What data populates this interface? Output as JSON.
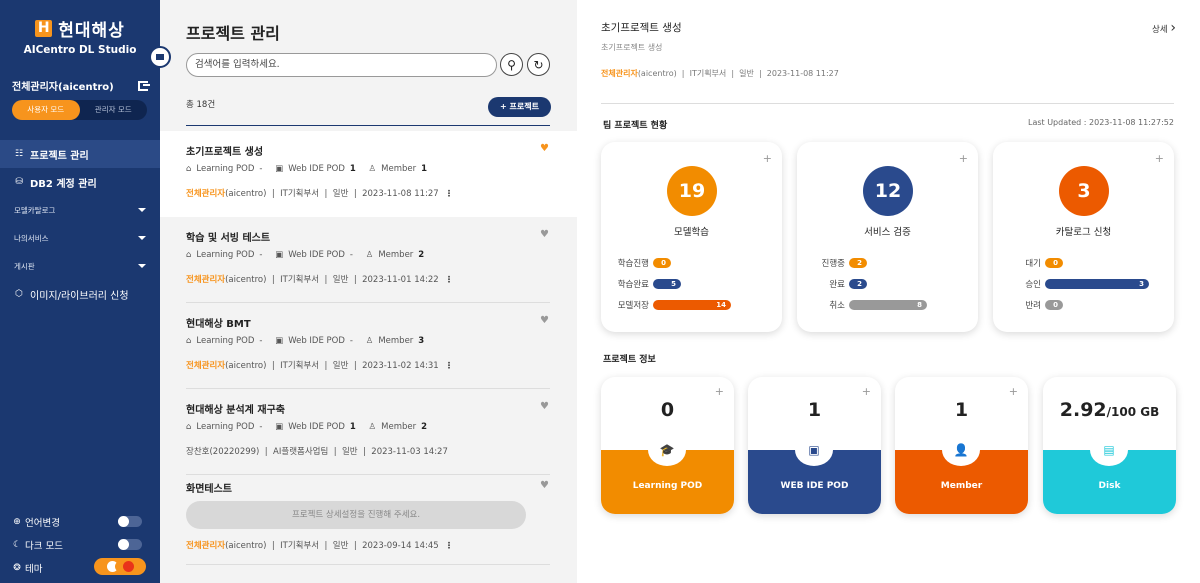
{
  "brand": {
    "name": "현대해상",
    "mark": "H",
    "studio": "AICentro DL Studio"
  },
  "user": {
    "name": "전체관리자(aicentro)"
  },
  "mode": {
    "user": "사용자 모드",
    "admin": "관리자 모드"
  },
  "nav": [
    {
      "label": "프로젝트 관리",
      "icon": "project-list-icon",
      "glyph": "☷"
    },
    {
      "label": "DB2 계정 관리",
      "icon": "database-icon",
      "glyph": "⛁"
    },
    {
      "label": "모델카탈로그"
    },
    {
      "label": "나의서비스"
    },
    {
      "label": "게시판"
    },
    {
      "label": "이미지/라이브러리 신청",
      "icon": "cube-icon",
      "glyph": "⬡"
    }
  ],
  "bottom": {
    "language": "언어변경",
    "dark": "다크 모드",
    "theme": "테마"
  },
  "list": {
    "title": "프로젝트 관리",
    "search_placeholder": "검색어를 입력하세요.",
    "count": "총 18건",
    "add": "+ 프로젝트",
    "labels": {
      "learning": "Learning POD",
      "webide": "Web IDE POD",
      "member": "Member"
    },
    "incomplete_msg": "프로젝트 상세설정을 진행해 주세요.",
    "items": [
      {
        "name": "초기프로젝트 생성",
        "learning": "-",
        "webide": "1",
        "member": "1",
        "owner": "전체관리자",
        "owner_id": "(aicentro)",
        "dept": "IT기획부서",
        "type": "일반",
        "date": "2023-11-08 11:27"
      },
      {
        "name": "학습 및 서빙 테스트",
        "learning": "-",
        "webide": "-",
        "member": "2",
        "owner": "전체관리자",
        "owner_id": "(aicentro)",
        "dept": "IT기획부서",
        "type": "일반",
        "date": "2023-11-01 14:22"
      },
      {
        "name": "현대해상 BMT",
        "learning": "-",
        "webide": "-",
        "member": "3",
        "owner": "전체관리자",
        "owner_id": "(aicentro)",
        "dept": "IT기획부서",
        "type": "일반",
        "date": "2023-11-02 14:31"
      },
      {
        "name": "현대해상 분석계 재구축",
        "learning": "-",
        "webide": "1",
        "member": "2",
        "owner": "장찬호",
        "owner_id": "(20220299)",
        "dept": "AI플랫폼사업팀",
        "type": "일반",
        "date": "2023-11-03 14:27"
      },
      {
        "name": "화면테스트",
        "owner": "전체관리자",
        "owner_id": "(aicentro)",
        "dept": "IT기획부서",
        "type": "일반",
        "date": "2023-09-14 14:45"
      }
    ]
  },
  "detail": {
    "title": "초기프로젝트 생성",
    "subtitle": "초기프로젝트 생성",
    "owner": "전체관리자",
    "owner_id": "(aicentro)",
    "dept": "IT기획부서",
    "type": "일반",
    "date": "2023-11-08 11:27",
    "more": "상세",
    "team_title": "팀 프로젝트 현황",
    "updated": "Last Updated : 2023-11-08 11:27:52",
    "cards": [
      {
        "count": "19",
        "label": "모델학습",
        "color": "#f28c00",
        "rows": [
          {
            "label": "학습진행",
            "value": "0",
            "pct": 0.0,
            "color": "#f28c00"
          },
          {
            "label": "학습완료",
            "value": "5",
            "pct": 0.36,
            "color": "#2a4a8d"
          },
          {
            "label": "모델저장",
            "value": "14",
            "pct": 1.0,
            "color": "#ec5a00"
          }
        ]
      },
      {
        "count": "12",
        "label": "서비스 검증",
        "color": "#2a4a8d",
        "rows": [
          {
            "label": "진행중",
            "value": "2",
            "pct": 0.0,
            "color": "#f28c00"
          },
          {
            "label": "완료",
            "value": "2",
            "pct": 0.0,
            "color": "#2a4a8d"
          },
          {
            "label": "취소",
            "value": "8",
            "pct": 1.0,
            "color": "#999999"
          }
        ]
      },
      {
        "count": "3",
        "label": "카탈로그 신청",
        "color": "#ec5a00",
        "rows": [
          {
            "label": "대기",
            "value": "0",
            "pct": 0.0,
            "color": "#f28c00"
          },
          {
            "label": "승인",
            "value": "3",
            "pct": 1.0,
            "color": "#2a4a8d"
          },
          {
            "label": "반려",
            "value": "0",
            "pct": 0.0,
            "color": "#999999"
          }
        ]
      }
    ],
    "info_title": "프로젝트 정보",
    "info": [
      {
        "value": "0",
        "label": "Learning POD",
        "color": "#f28c00",
        "icon": "graduation-cap-icon",
        "glyph": "🎓"
      },
      {
        "value": "1",
        "label": "WEB IDE POD",
        "color": "#2a4a8d",
        "icon": "terminal-icon",
        "glyph": "▣"
      },
      {
        "value": "1",
        "label": "Member",
        "color": "#ec5a00",
        "icon": "user-icon",
        "glyph": "👤"
      },
      {
        "value": "2.92",
        "unit": "/100 GB",
        "label": "Disk",
        "color": "#1fc9d9",
        "icon": "server-icon",
        "glyph": "▤"
      }
    ]
  }
}
